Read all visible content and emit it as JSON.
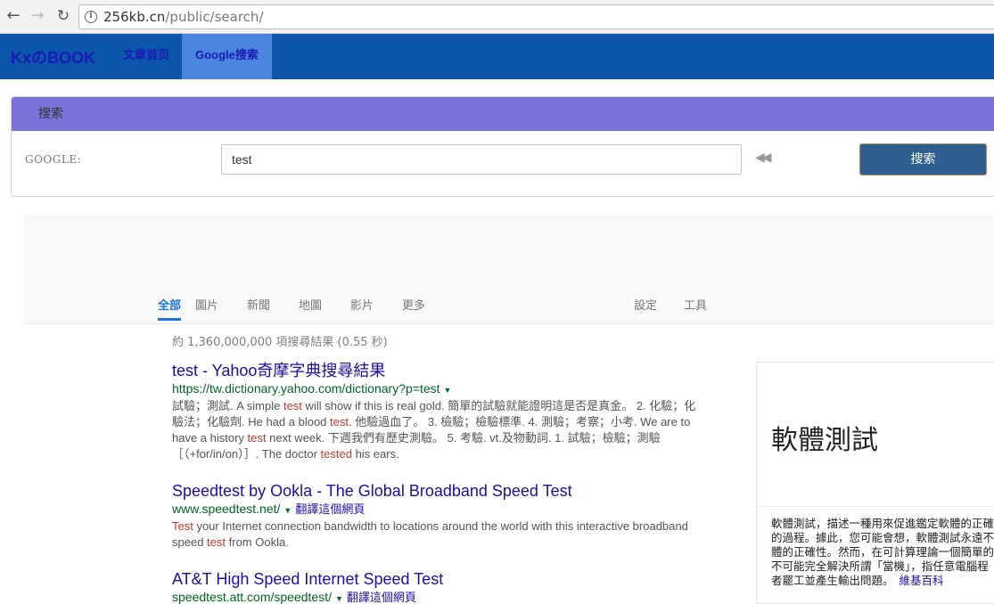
{
  "browser": {
    "url_host": "256kb.cn",
    "url_path": "/public/search/"
  },
  "site_nav": {
    "brand": "KxのBOOK",
    "links": [
      "文章首页",
      "Google搜索"
    ]
  },
  "search_panel": {
    "title": "搜索",
    "label": "GOOGLE:",
    "input_value": "test",
    "button_label": "搜索"
  },
  "google": {
    "tabs": [
      "全部",
      "圖片",
      "新聞",
      "地圖",
      "影片",
      "更多",
      "設定",
      "工具"
    ],
    "stats": "約 1,360,000,000 項搜尋結果 (0.55 秒)",
    "results": [
      {
        "title": "test - Yahoo奇摩字典搜尋結果",
        "url": "https://tw.dictionary.yahoo.com/dictionary?p=test",
        "translate": "",
        "snippet_lines": [
          [
            "試驗；測試. A simple ",
            "test",
            " will show if this is real gold. 簡單的試驗就能證明這是否是真金。 2. 化驗；化"
          ],
          [
            "驗法；化驗劑. He had a blood ",
            "test",
            ". 他驗過血了。 3. 檢驗；檢驗標準. 4. 測驗；考察；小考. We are to"
          ],
          [
            "have a history ",
            "test",
            " next week. 下週我們有歷史測驗。 5. 考驗. vt.及物動詞. 1. 試驗；檢驗；測驗"
          ],
          [
            "［（+for/in/on）］. The doctor ",
            "tested",
            " his ears."
          ]
        ]
      },
      {
        "title": "Speedtest by Ookla - The Global Broadband Speed Test",
        "url": "www.speedtest.net/",
        "translate": "翻譯這個網頁",
        "snippet_lines": [
          [
            "",
            "Test",
            " your Internet connection bandwidth to locations around the world with this interactive broadband"
          ],
          [
            "speed ",
            "test",
            " from Ookla."
          ]
        ]
      },
      {
        "title": "AT&T High Speed Internet Speed Test",
        "url": "speedtest.att.com/speedtest/",
        "translate": "翻譯這個網頁",
        "snippet_lines": []
      }
    ],
    "knowledge_panel": {
      "title": "軟體測試",
      "desc_lines": [
        "軟體測試，描述一種用來促進鑑定軟體的正確",
        "的過程。據此，您可能會想，軟體測試永遠不",
        "體的正確性。然而，在可計算理論一個簡單的",
        "不可能完全解決所謂「當機」，指任意電腦程",
        "者罷工並產生輸出問題。"
      ],
      "source": "維基百科"
    }
  }
}
